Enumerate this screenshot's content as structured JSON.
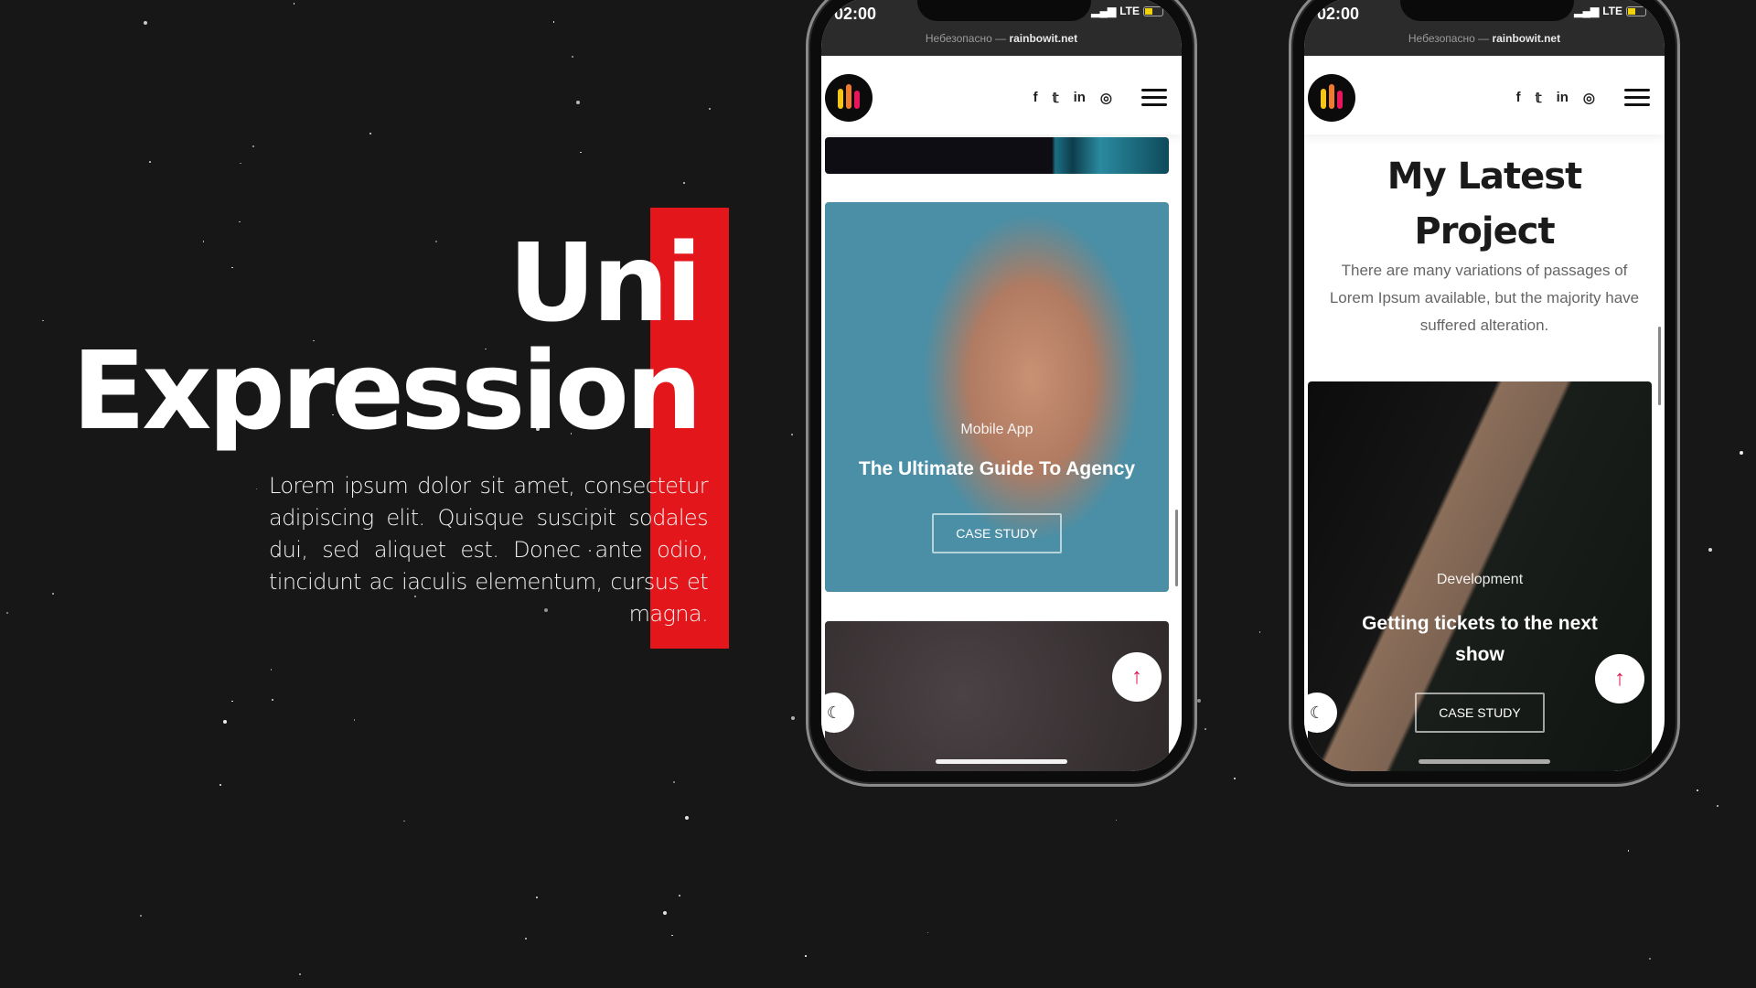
{
  "hero": {
    "title_line1": "Uni",
    "title_line2": "Expression",
    "paragraph": "Lorem ipsum dolor sit amet, consectetur adipiscing elit. Quisque suscipit sodales dui, sed aliquet est. Donec ante odio, tincidunt ac iaculis elementum, cursus et magna.",
    "accent_color": "#e3171b"
  },
  "phones": [
    {
      "status": {
        "time": "02:00",
        "network": "LTE"
      },
      "address_bar": {
        "label": "Небезопасно — ",
        "domain": "rainbowit.net"
      },
      "social": [
        "f",
        "𝕥",
        "in",
        "◎"
      ],
      "card": {
        "category": "Mobile App",
        "title": "The Ultimate Guide To Agency",
        "button": "CASE STUDY"
      },
      "fab_icon": "↑",
      "theme_icon": "☾"
    },
    {
      "status": {
        "time": "02:00",
        "network": "LTE"
      },
      "address_bar": {
        "label": "Небезопасно — ",
        "domain": "rainbowit.net"
      },
      "social": [
        "f",
        "𝕥",
        "in",
        "◎"
      ],
      "section": {
        "title": "My Latest Project",
        "description": "There are many variations of passages of Lorem Ipsum available, but the majority have suffered alteration."
      },
      "card": {
        "category": "Development",
        "title": "Getting tickets to the next show",
        "button": "CASE STUDY"
      },
      "fab_icon": "↑",
      "theme_icon": "☾"
    }
  ],
  "colors": {
    "background": "#171717",
    "fab_arrow": "#e0144d",
    "logo_bars": [
      "#f5c518",
      "#f07b2a",
      "#e8175d"
    ]
  }
}
